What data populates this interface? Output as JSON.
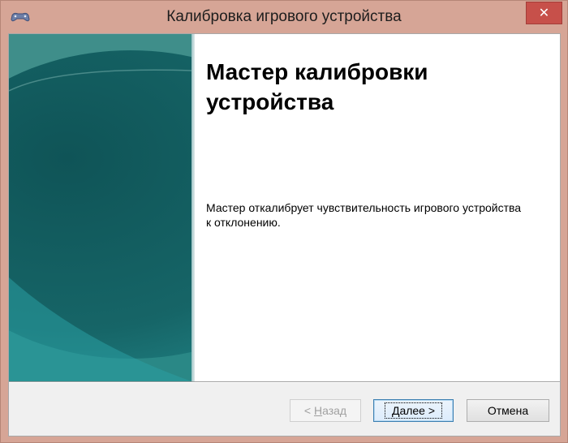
{
  "window": {
    "title": "Калибровка игрового устройства",
    "close_label": "✕",
    "app_icon": "gamepad-icon"
  },
  "main": {
    "heading_line1": "Мастер калибровки",
    "heading_line2": "устройства",
    "description_line1": "Мастер откалибрует чувствительность игрового устройства",
    "description_line2": "к отклонению."
  },
  "footer": {
    "back_prefix": "< ",
    "back_hotkey": "Н",
    "back_rest": "азад",
    "next_hotkey": "Д",
    "next_rest": "алее >",
    "cancel_label": "Отмена"
  },
  "colors": {
    "titlebar": "#d6a596",
    "close_button": "#c7504a",
    "sidebar_teal": "#1e6b6c",
    "focus_border": "#3c7fb1"
  }
}
